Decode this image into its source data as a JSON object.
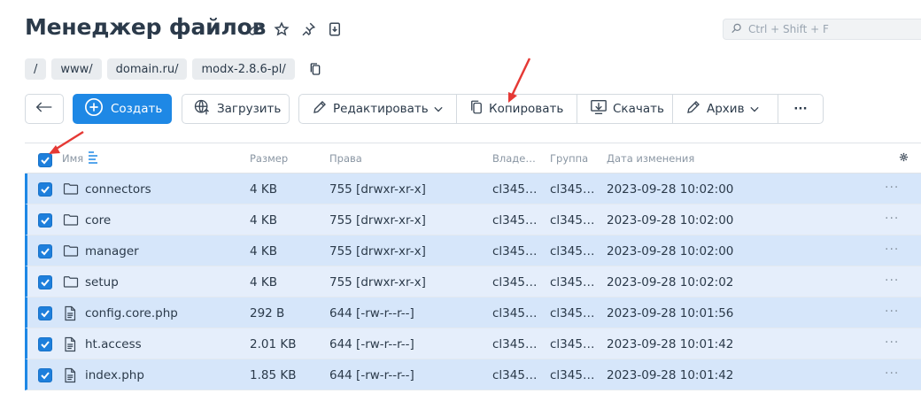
{
  "header": {
    "title": "Менеджер файлов",
    "search_placeholder": "Ctrl + Shift + F"
  },
  "breadcrumbs": [
    "/",
    "www/",
    "domain.ru/",
    "modx-2.8.6-pl/"
  ],
  "toolbar": {
    "create_label": "Создать",
    "upload_label": "Загрузить",
    "edit_label": "Редактировать",
    "copy_label": "Копировать",
    "download_label": "Скачать",
    "archive_label": "Архив",
    "more_label": "···"
  },
  "table": {
    "columns": {
      "name": "Имя",
      "size": "Размер",
      "perms": "Права",
      "owner": "Владе…",
      "group": "Группа",
      "modified": "Дата изменения"
    },
    "rows": [
      {
        "type": "folder",
        "name": "connectors",
        "size": "4 KB",
        "perms": "755 [drwxr-xr-x]",
        "owner": "cl345…",
        "group": "cl345…",
        "modified": "2023-09-28 10:02:00"
      },
      {
        "type": "folder",
        "name": "core",
        "size": "4 KB",
        "perms": "755 [drwxr-xr-x]",
        "owner": "cl345…",
        "group": "cl345…",
        "modified": "2023-09-28 10:02:00"
      },
      {
        "type": "folder",
        "name": "manager",
        "size": "4 KB",
        "perms": "755 [drwxr-xr-x]",
        "owner": "cl345…",
        "group": "cl345…",
        "modified": "2023-09-28 10:02:00"
      },
      {
        "type": "folder",
        "name": "setup",
        "size": "4 KB",
        "perms": "755 [drwxr-xr-x]",
        "owner": "cl345…",
        "group": "cl345…",
        "modified": "2023-09-28 10:02:02"
      },
      {
        "type": "file",
        "name": "config.core.php",
        "size": "292 B",
        "perms": "644 [-rw-r--r--]",
        "owner": "cl345…",
        "group": "cl345…",
        "modified": "2023-09-28 10:01:56"
      },
      {
        "type": "file",
        "name": "ht.access",
        "size": "2.01 KB",
        "perms": "644 [-rw-r--r--]",
        "owner": "cl345…",
        "group": "cl345…",
        "modified": "2023-09-28 10:01:42"
      },
      {
        "type": "file",
        "name": "index.php",
        "size": "1.85 KB",
        "perms": "644 [-rw-r--r--]",
        "owner": "cl345…",
        "group": "cl345…",
        "modified": "2023-09-28 10:01:42"
      }
    ],
    "row_more": "···"
  },
  "colors": {
    "accent": "#1e88e5",
    "row_odd": "#d6e6fa",
    "row_even": "#e5eefb",
    "annotation_arrow": "#e53935"
  }
}
